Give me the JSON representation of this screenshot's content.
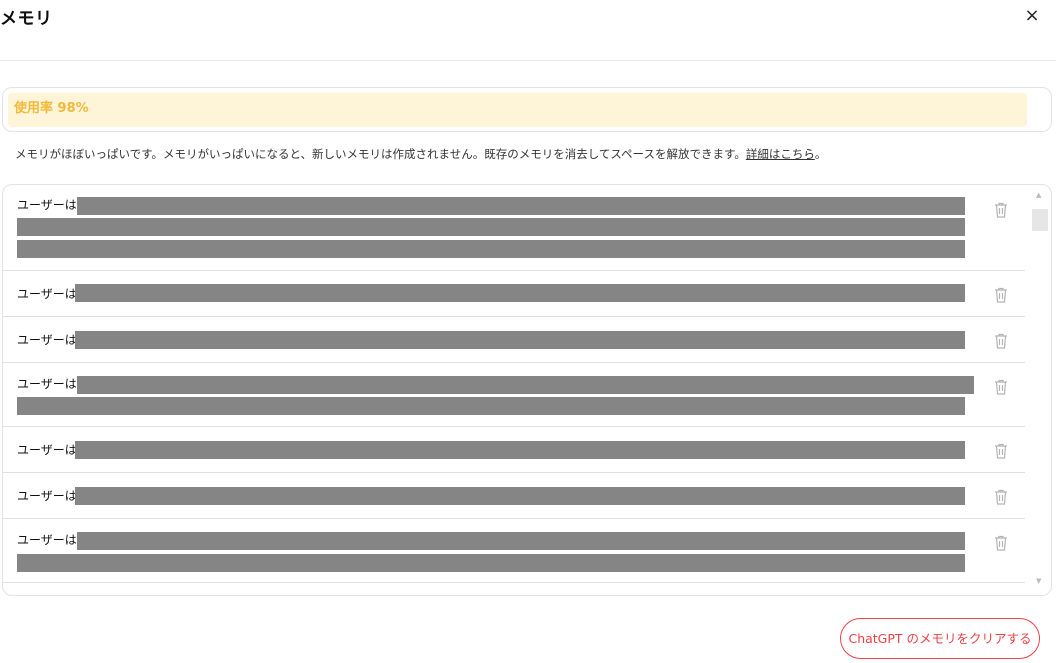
{
  "dialog": {
    "title": "メモリ",
    "close_glyph": "×"
  },
  "usage": {
    "label": "使用率 98%",
    "percent": 98,
    "color": "#f2b93b",
    "bar_bg": "#fef5d8"
  },
  "notice": {
    "text": "メモリがほぼいっぱいです。メモリがいっぱいになると、新しいメモリは作成されません。既存のメモリを消去してスペースを解放できます。",
    "link_label": "詳細はこちら",
    "suffix": "。"
  },
  "memories": [
    {
      "prefix": "ユーザーは",
      "redacted": true
    },
    {
      "prefix": "ユーザーは",
      "redacted": true
    },
    {
      "prefix": "ユーザーは",
      "redacted": true
    },
    {
      "prefix": "ユーザーは",
      "redacted": true
    },
    {
      "prefix": "ユーザーは",
      "redacted": true
    },
    {
      "prefix": "ユーザーは",
      "redacted": true
    },
    {
      "prefix": "ユーザーは",
      "redacted": true
    }
  ],
  "icons": {
    "close": "close-icon",
    "delete": "trash-icon",
    "scroll_up": "scroll-up-arrow-icon",
    "scroll_down": "scroll-down-arrow-icon"
  },
  "scroll": {
    "up_glyph": "▲",
    "down_glyph": "▼"
  },
  "footer": {
    "clear_button_label": "ChatGPT のメモリをクリアする",
    "accent": "#ef4146"
  }
}
